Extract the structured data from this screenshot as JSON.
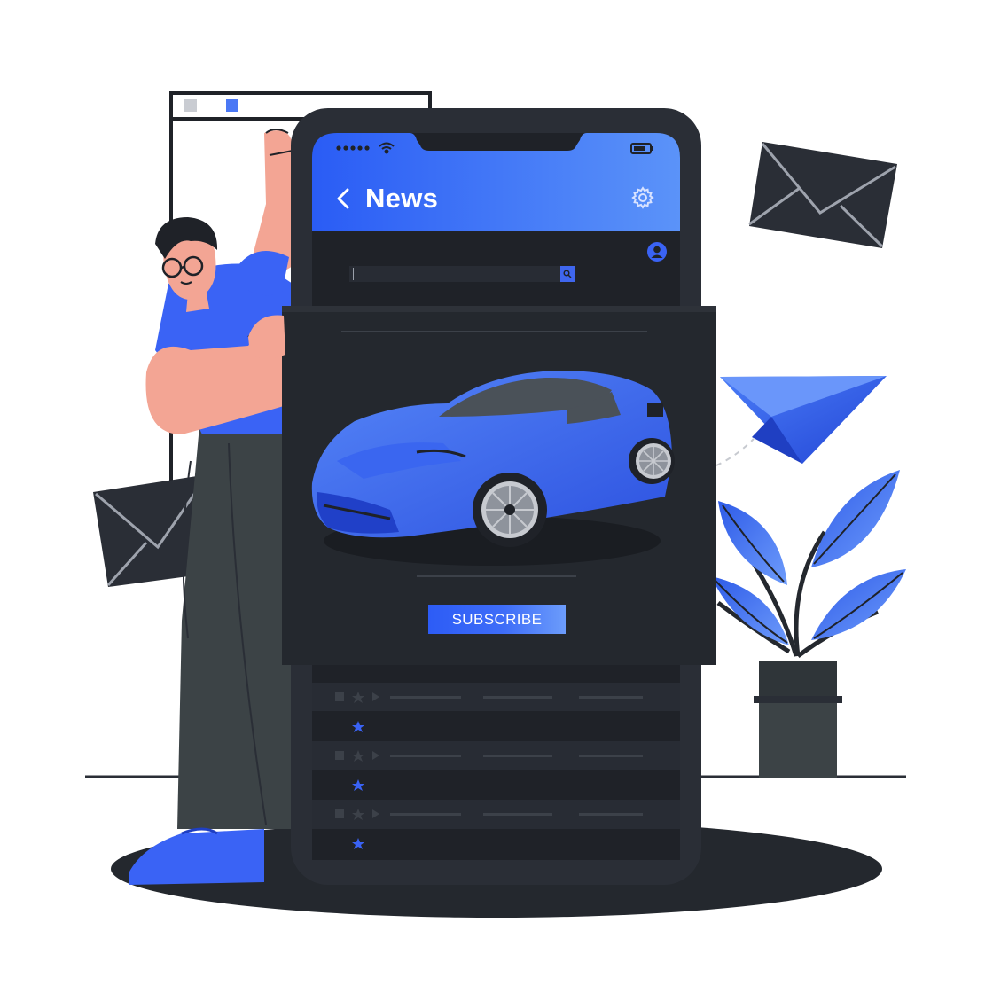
{
  "header": {
    "title": "News",
    "back_icon": "chevron-left-icon",
    "settings_icon": "gear-icon"
  },
  "search": {
    "value": "",
    "icon": "search-icon"
  },
  "promo": {
    "subscribe_label": "SUBSCRIBE"
  },
  "colors": {
    "accent": "#3a63f5",
    "accent_light": "#5b8cf9",
    "dark_bg": "#1f2228",
    "panel": "#282c34",
    "phone_frame": "#2a2e36",
    "skin": "#f3a594",
    "pants": "#3c4346"
  }
}
